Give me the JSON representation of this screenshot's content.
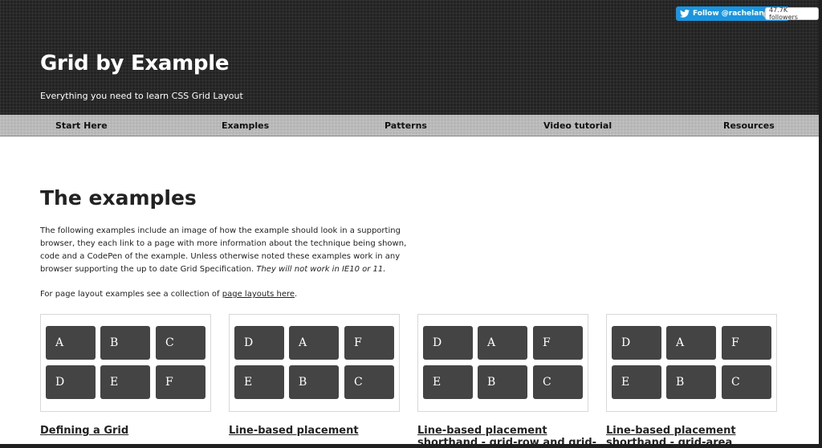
{
  "header": {
    "title": "Grid by Example",
    "tagline": "Everything you need to learn CSS Grid Layout",
    "twitter": {
      "follow_label": "Follow @rachelandrew",
      "followers": "47.7K followers",
      "icon": "twitter-bird-icon",
      "color": "#1b95e0"
    }
  },
  "nav": {
    "items": [
      {
        "label": "Start Here"
      },
      {
        "label": "Examples"
      },
      {
        "label": "Patterns"
      },
      {
        "label": "Video tutorial"
      },
      {
        "label": "Resources"
      }
    ]
  },
  "main": {
    "heading": "The examples",
    "intro": "The following examples include an image of how the example should look in a supporting browser, they each link to a page with more information about the technique being shown, code and a CodePen of the example. Unless otherwise noted these examples work in any browser supporting the up to date Grid Specification.",
    "intro_note": "They will not work in IE10 or 11.",
    "layouts_prefix": "For page layout examples see a collection of",
    "layouts_link": "page layouts here",
    "layouts_suffix": ".",
    "examples": [
      {
        "cells": [
          "A",
          "B",
          "C",
          "D",
          "E",
          "F"
        ],
        "title": "Defining a Grid",
        "title_line2": ""
      },
      {
        "cells": [
          "D",
          "A",
          "F",
          "E",
          "B",
          "C"
        ],
        "title": "Line-based placement",
        "title_line2": ""
      },
      {
        "cells": [
          "D",
          "A",
          "F",
          "E",
          "B",
          "C"
        ],
        "title": "Line-based placement",
        "title_line2": "shorthand - grid-row and grid-"
      },
      {
        "cells": [
          "D",
          "A",
          "F",
          "E",
          "B",
          "C"
        ],
        "title": "Line-based placement",
        "title_line2": "shorthand - grid-area"
      }
    ]
  },
  "colors": {
    "header_bg": "#232323",
    "nav_bg": "#b5b5b5",
    "cell_bg": "#444444"
  }
}
